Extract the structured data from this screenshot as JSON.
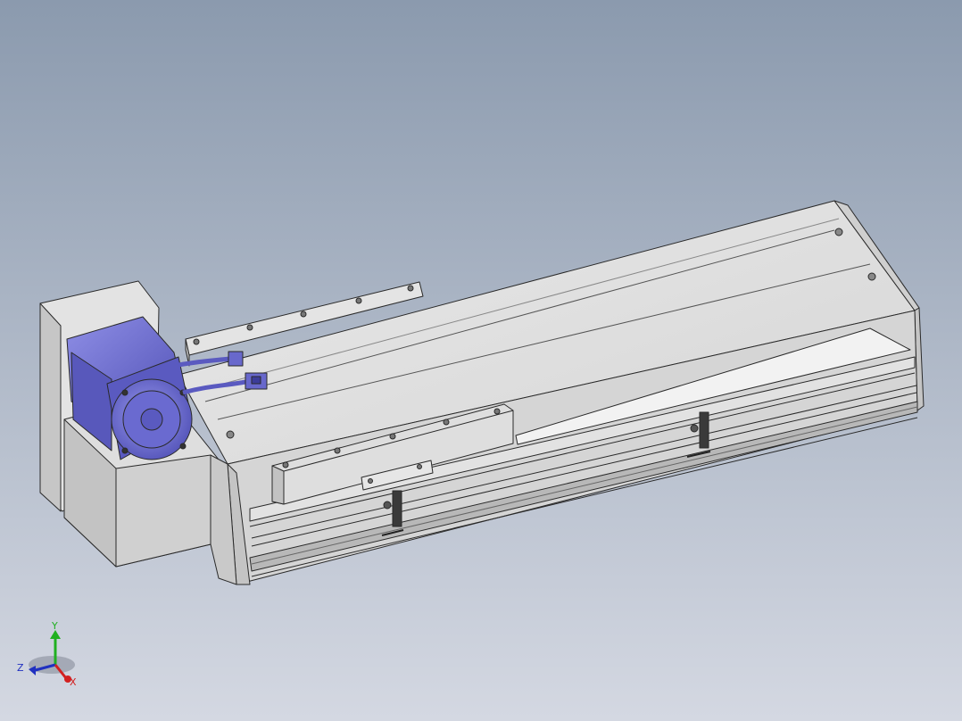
{
  "viewport": {
    "background_top": "#8b9aae",
    "background_bottom": "#d4d8e2"
  },
  "colors": {
    "body": "#dcdcdc",
    "body_light": "#ebebeb",
    "body_dark": "#b9b9b9",
    "edge": "#2a2a2a",
    "motor": "#6c6cd2",
    "motor_dark": "#4545a8",
    "motor_light": "#8f8fe6",
    "axis_x": "#d22020",
    "axis_y": "#20b020",
    "axis_z": "#2030c0"
  },
  "triad": {
    "x_label": "X",
    "y_label": "Y",
    "z_label": "Z"
  }
}
